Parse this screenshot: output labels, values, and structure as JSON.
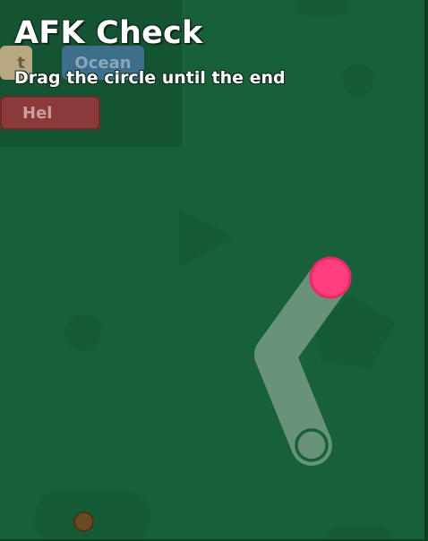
{
  "afk_check": {
    "title": "AFK Check",
    "instruction": "Drag the circle until the end",
    "drag_progress": 0
  },
  "biome_buttons": {
    "desert_label": "t",
    "ocean_label": "Ocean",
    "hel_label": "Hel"
  },
  "colors": {
    "background": "#17603a",
    "drag_handle": "#ff3d7f",
    "track": "#7fa08c"
  }
}
